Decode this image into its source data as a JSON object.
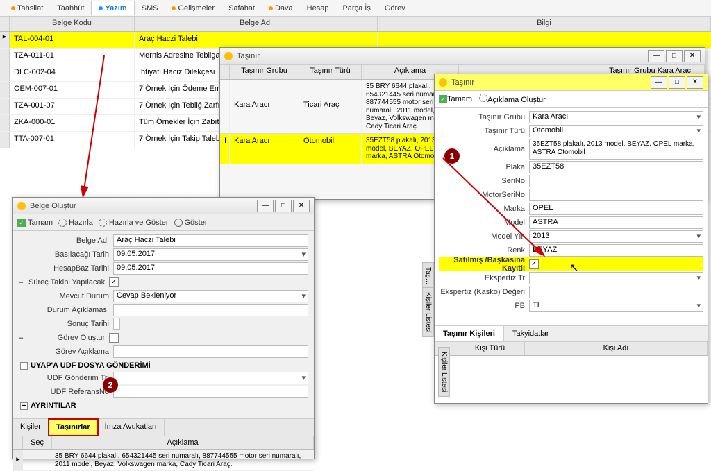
{
  "tabs": [
    "Tahsilat",
    "Taahhüt",
    "Yazım",
    "SMS",
    "Gelişmeler",
    "Safahat",
    "Dava",
    "Hesap",
    "Parça İş",
    "Görev"
  ],
  "active_tab_index": 2,
  "grid_headers": {
    "kodu": "Belge Kodu",
    "adi": "Belge Adı",
    "bilgi": "Bilgi"
  },
  "grid_rows": [
    {
      "kodu": "TAL-004-01",
      "adi": "Araç Haczi Talebi",
      "selected": true
    },
    {
      "kodu": "TZA-011-01",
      "adi": "Mernis Adresine Tebliga"
    },
    {
      "kodu": "DLC-002-04",
      "adi": "İhtiyati Haciz Dilekçesi"
    },
    {
      "kodu": "OEM-007-01",
      "adi": "7 Örnek İçin Ödeme Emri"
    },
    {
      "kodu": "TZA-001-07",
      "adi": "7 Örnek İçin Tebliğ Zarfı"
    },
    {
      "kodu": "ZKA-000-01",
      "adi": "Tüm Örnekler İçin Zabıt K"
    },
    {
      "kodu": "TTA-007-01",
      "adi": "7 Örnek İçin Takip Taleb"
    }
  ],
  "belge": {
    "title": "Belge Oluştur",
    "toolbar": {
      "tamam": "Tamam",
      "hazirla": "Hazırla",
      "hazirla_goster": "Hazırla ve Göster",
      "goster": "Göster"
    },
    "labels": {
      "belge_adi": "Belge Adı",
      "basilacagi_tarih": "Basılacağı Tarih",
      "hesapbaz_tarihi": "HesapBaz Tarihi",
      "surec_takibi": "Süreç Takibi Yapılacak",
      "mevcut_durum": "Mevcut Durum",
      "durum_aciklamasi": "Durum Açıklaması",
      "sonuc_tarihi": "Sonuç Tarihi",
      "gorev_olustur": "Görev Oluştur",
      "gorev_aciklama": "Görev Açıklama",
      "uyap_head": "UYAP'A UDF DOSYA GÖNDERİMİ",
      "udf_gonderim": "UDF Gönderim Tr.",
      "udf_ref": "UDF ReferansNo",
      "ayrintilar": "AYRINTILAR"
    },
    "values": {
      "belge_adi": "Araç Haczi Talebi",
      "basilacagi_tarih": "09.05.2017",
      "hesapbaz_tarihi": "09.05.2017",
      "surec_checked": "✓",
      "mevcut_durum": "Cevap Bekleniyor"
    },
    "subtabs": {
      "kisiler": "Kişiler",
      "tasinirlar": "Taşınırlar",
      "imza": "İmza Avukatları"
    },
    "inner_grid": {
      "sec": "Seç",
      "aciklama": "Açıklama",
      "row1": "35 BRY 6644 plakalı, 654321445 seri numaralı, 887744555 motor seri numaralı, 2011 model, Beyaz, Volkswagen marka, Cady Ticari Araç."
    }
  },
  "tasinir_outer": {
    "title": "Taşınır",
    "head": {
      "grubu": "Taşınır Grubu",
      "turu": "Taşınır Türü",
      "aciklama": "Açıklama"
    },
    "label_grubu": "Taşınır Grubu",
    "value_grubu": "Kara Aracı",
    "rows": [
      {
        "grubu": "Kara Aracı",
        "turu": "Ticari Araç",
        "aciklama": "35 BRY 6644 plakalı, 654321445 seri numaralı, 887744555 motor seri numaralı, 2011 model, Beyaz, Volkswagen marka, Cady Ticari Araç."
      },
      {
        "grubu": "Kara Aracı",
        "turu": "Otomobil",
        "aciklama": "35EZT58 plakalı, 2013 model, BEYAZ, OPEL marka, ASTRA Otomobil",
        "selected": true
      }
    ]
  },
  "tasinir_detail": {
    "title": "Taşınır",
    "toolbar": {
      "tamam": "Tamam",
      "aciklama_olustur": "Açıklama Oluştur"
    },
    "labels": {
      "grubu": "Taşınır Grubu",
      "turu": "Taşınır Türü",
      "aciklama": "Açıklama",
      "plaka": "Plaka",
      "serino": "SeriNo",
      "motorserino": "MotorSeriNo",
      "marka": "Marka",
      "model": "Model",
      "modelyili": "Model Yılı",
      "renk": "Renk",
      "satilmis": "Satılmış /Başkasına Kayıtlı",
      "ekspertiz_tr": "Ekspertiz Tr",
      "ekspertiz_deger": "Ekspertiz (Kasko) Değeri",
      "pb": "PB"
    },
    "values": {
      "grubu": "Kara Aracı",
      "turu": "Otomobil",
      "aciklama": "35EZT58 plakalı, 2013 model, BEYAZ, OPEL marka, ASTRA Otomobil",
      "plaka": "35EZT58",
      "marka": "OPEL",
      "model": "ASTRA",
      "modelyili": "2013",
      "renk": "BEYAZ",
      "pb": "TL",
      "satilmis_checked": "✓"
    },
    "pane": {
      "kisileri": "Taşınır Kişileri",
      "takyidat": "Takyidatlar",
      "kisi_turu": "Kişi Türü",
      "kisi_adi": "Kişi Adı"
    },
    "side_tabs": {
      "tas": "Taş…",
      "kisiler": "Kişiler Listesi"
    }
  },
  "callouts": {
    "one": "1",
    "two": "2"
  }
}
